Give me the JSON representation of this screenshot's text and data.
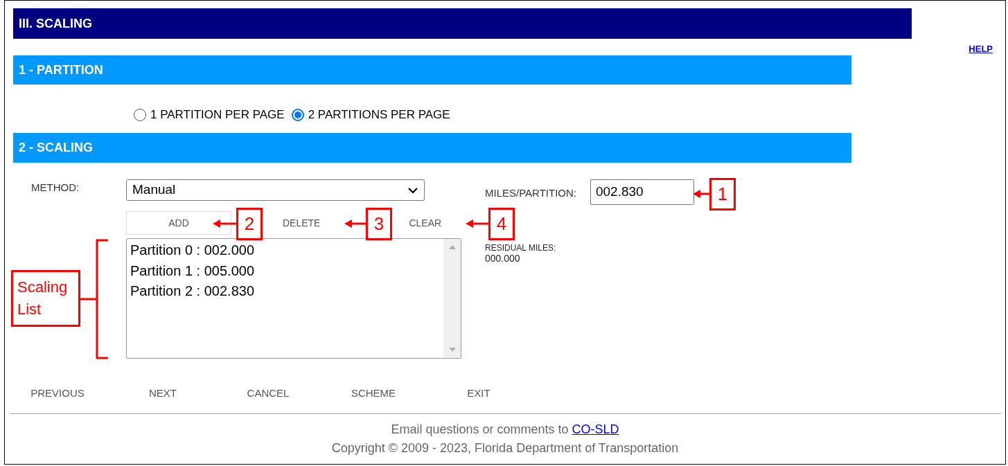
{
  "header": {
    "title": "III. SCALING"
  },
  "help_link": "HELP",
  "partition": {
    "heading": "1 - PARTITION",
    "options": [
      {
        "label": "1 PARTITION PER PAGE",
        "selected": false
      },
      {
        "label": "2 PARTITIONS PER PAGE",
        "selected": true
      }
    ]
  },
  "scaling": {
    "heading": "2 - SCALING",
    "method": {
      "label": "METHOD:",
      "value": "Manual"
    },
    "miles_per_partition": {
      "label": "MILES/PARTITION:",
      "value": "002.830"
    },
    "actions": [
      {
        "label": "ADD",
        "kind": "outlined"
      },
      {
        "label": "DELETE",
        "kind": "plain"
      },
      {
        "label": "CLEAR",
        "kind": "plain"
      }
    ],
    "residual": {
      "label": "RESIDUAL MILES:",
      "value": "000.000"
    },
    "list": {
      "items": [
        "Partition 0 : 002.000",
        "Partition 1 : 005.000",
        "Partition 2 : 002.830"
      ]
    }
  },
  "nav_buttons": [
    "PREVIOUS",
    "NEXT",
    "CANCEL",
    "SCHEME",
    "EXIT"
  ],
  "footer": {
    "text": "Email questions or comments to",
    "link": "CO-SLD",
    "copyright": "Copyright © 2009 - 2023, Florida Department of Transportation"
  },
  "annotations": [
    {
      "label": "1",
      "kind": "number"
    },
    {
      "label": "2",
      "kind": "number"
    },
    {
      "label": "3",
      "kind": "number"
    },
    {
      "label": "4",
      "kind": "number"
    },
    {
      "label": "Scaling List",
      "kind": "bracket"
    }
  ]
}
